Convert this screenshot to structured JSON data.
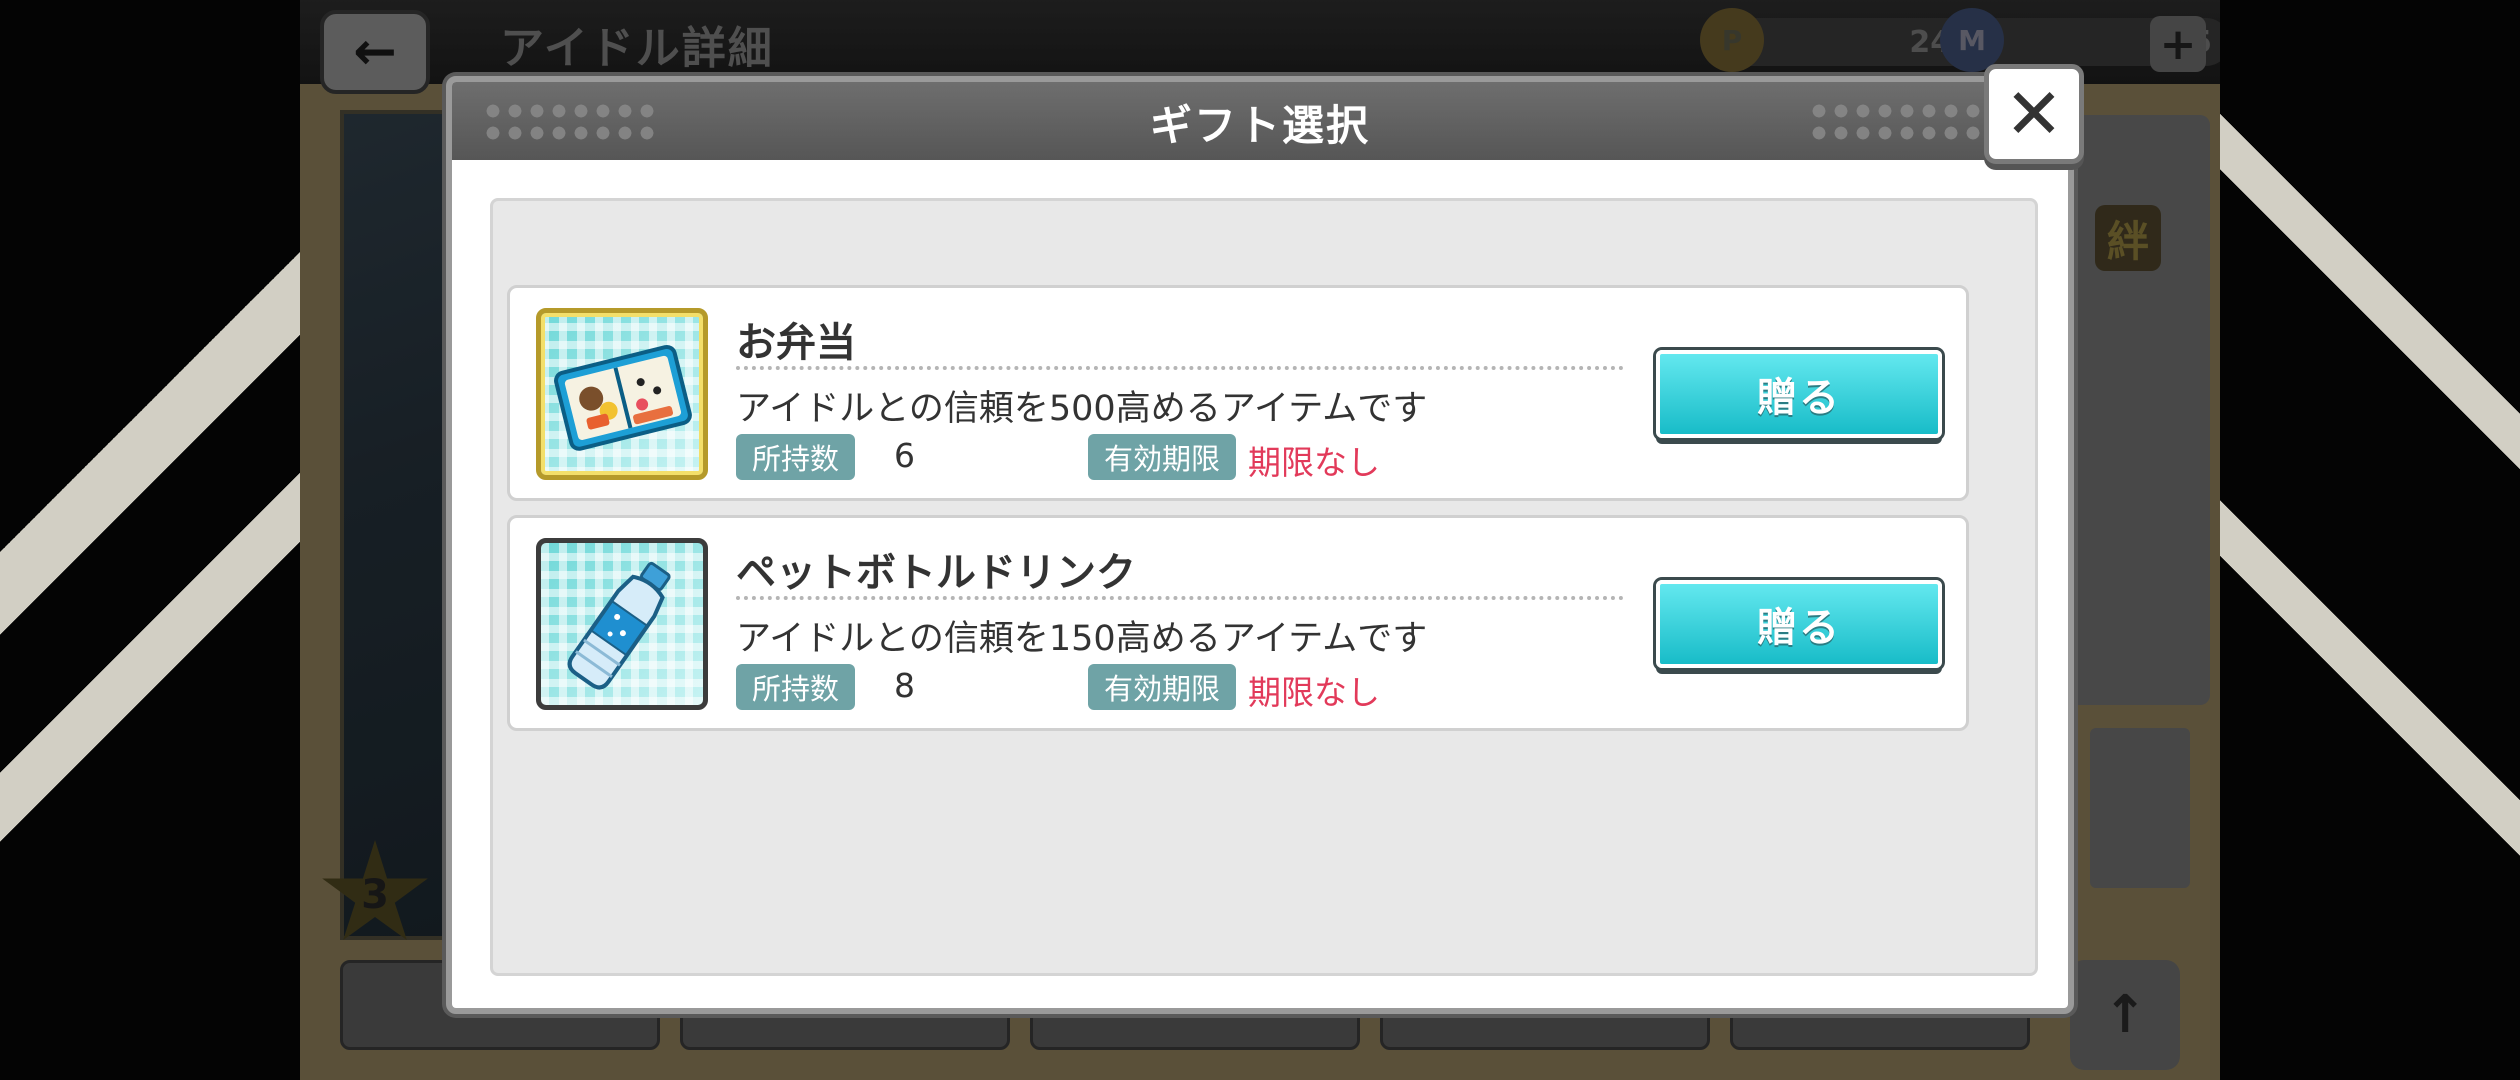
{
  "background": {
    "header_title": "アイドル詳細",
    "currency_p_icon": "P",
    "currency_p_value": "240",
    "currency_m_icon": "M",
    "currency_m_value": "5",
    "rank_star": "3",
    "bond_badge": "絆"
  },
  "modal": {
    "title": "ギフト選択",
    "close_label": "✕"
  },
  "gifts": [
    {
      "name": "お弁当",
      "description": "アイドルとの信頼を500高めるアイテムです",
      "owned_label": "所持数",
      "owned_value": "6",
      "expiry_label": "有効期限",
      "expiry_value": "期限なし",
      "send_label": "贈る",
      "icon": "bento-icon"
    },
    {
      "name": "ペットボトルドリンク",
      "description": "アイドルとの信頼を150高めるアイテムです",
      "owned_label": "所持数",
      "owned_value": "8",
      "expiry_label": "有効期限",
      "expiry_value": "期限なし",
      "send_label": "贈る",
      "icon": "water-bottle-icon"
    }
  ],
  "colors": {
    "send_button": "#18bcc8",
    "tag": "#6fa3a6",
    "expiry_text": "#e23a5a"
  }
}
